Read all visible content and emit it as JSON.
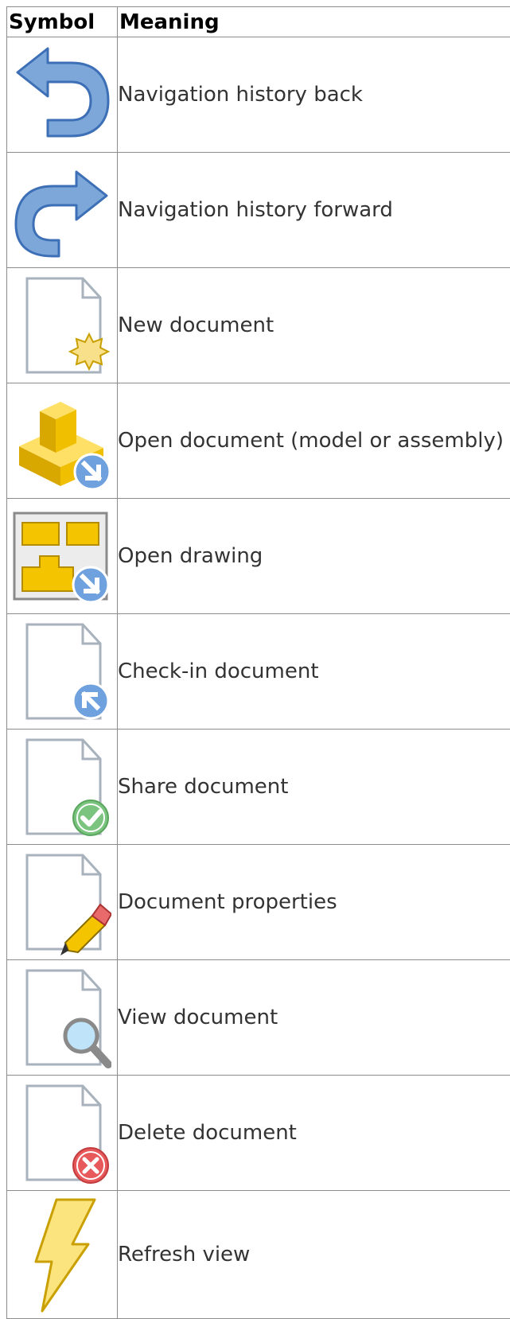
{
  "table": {
    "headers": [
      "Symbol",
      "Meaning"
    ],
    "rows": [
      {
        "icon": "navigation-back-icon",
        "meaning": "Navigation history back"
      },
      {
        "icon": "navigation-forward-icon",
        "meaning": "Navigation history forward"
      },
      {
        "icon": "new-document-icon",
        "meaning": "New document"
      },
      {
        "icon": "open-model-icon",
        "meaning": "Open document (model or assembly)"
      },
      {
        "icon": "open-drawing-icon",
        "meaning": "Open drawing"
      },
      {
        "icon": "check-in-document-icon",
        "meaning": "Check-in document"
      },
      {
        "icon": "share-document-icon",
        "meaning": "Share document"
      },
      {
        "icon": "document-properties-icon",
        "meaning": "Document properties"
      },
      {
        "icon": "view-document-icon",
        "meaning": "View document"
      },
      {
        "icon": "delete-document-icon",
        "meaning": "Delete document"
      },
      {
        "icon": "refresh-view-icon",
        "meaning": "Refresh view"
      }
    ]
  },
  "colors": {
    "arrow_blue": "#7da7d9",
    "arrow_outline": "#3d6fb6",
    "doc_outline": "#a8b2bd",
    "gold": "#f2c200",
    "gold_dark": "#c9a000",
    "check_green": "#7ac47f",
    "delete_red": "#e8595b",
    "badge_blue": "#6ea1de"
  }
}
